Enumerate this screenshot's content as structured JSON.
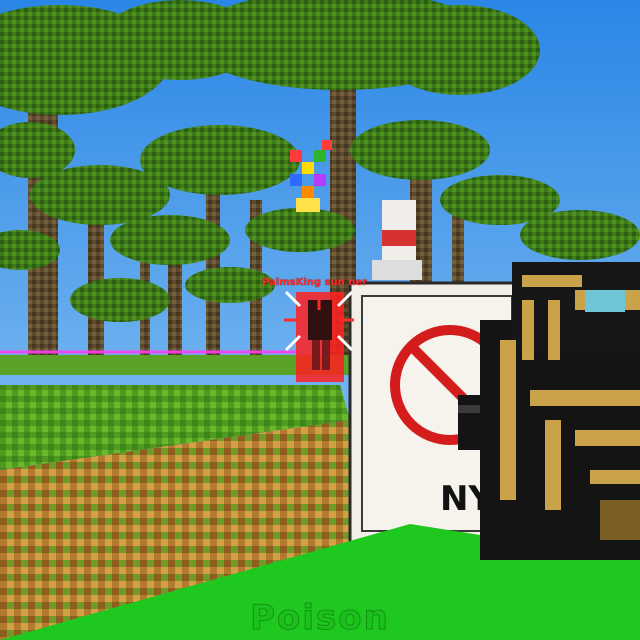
{
  "hud": {
    "enemy_nametag": "PalmsKing sun ner",
    "weapon_name": "Poison",
    "crosshair": "crosshair-icon",
    "hit_marker": "hit-marker-icon"
  },
  "sign": {
    "text": "NY",
    "symbol": "no-entry-sign-icon"
  },
  "colors": {
    "sky": "#2f8be6",
    "grass": "#4f9a1f",
    "dirt": "#b27a2c",
    "foreground_block": "#1ec81e",
    "laser": "#ff3df0",
    "enemy_highlight": "#ff2020",
    "gun_body": "#141414",
    "gun_gold": "#c9a24a"
  }
}
